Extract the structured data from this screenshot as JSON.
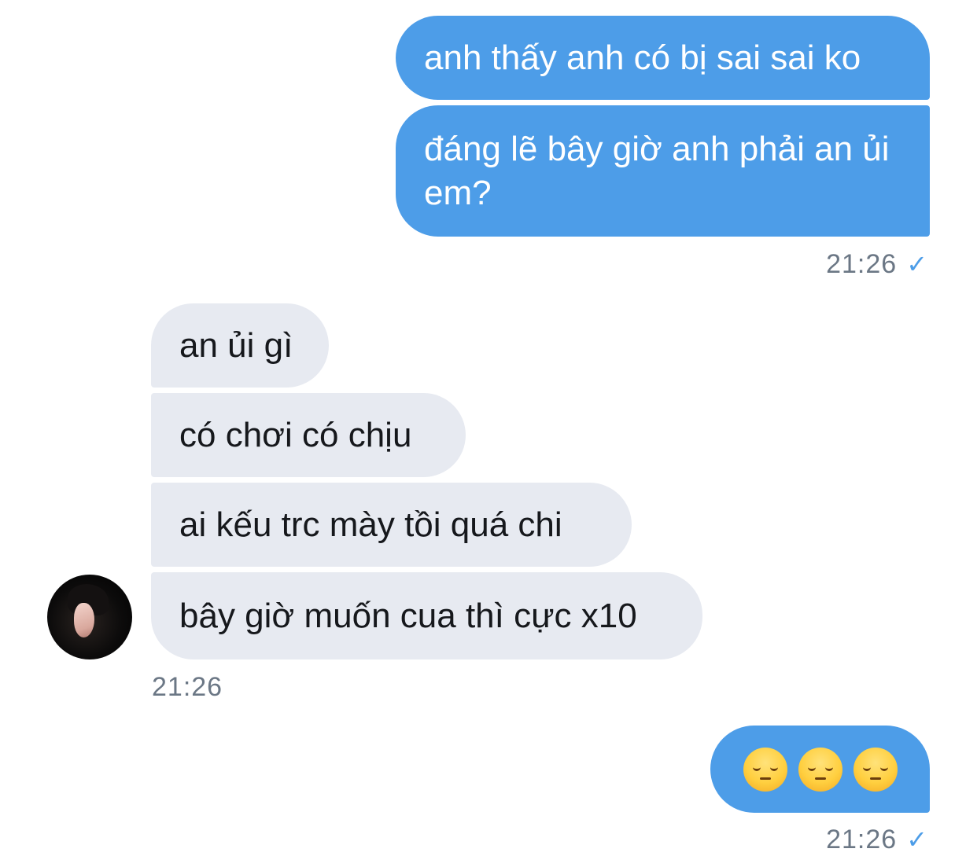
{
  "conversation": {
    "outgoing_group_1": {
      "messages": [
        "anh thấy anh có bị sai sai ko",
        "đáng lẽ bây giờ anh phải an ủi em?"
      ],
      "time": "21:26",
      "status_icon": "checkmark-icon",
      "check_glyph": "✓"
    },
    "incoming_group": {
      "avatar": "contact-avatar",
      "messages": [
        "an ủi gì",
        "có chơi có chịu",
        "ai kếu trc mày tồi quá chi",
        "bây giờ muốn cua thì cực x10"
      ],
      "time": "21:26"
    },
    "outgoing_group_2": {
      "emojis": [
        "pensive-face-emoji",
        "pensive-face-emoji",
        "pensive-face-emoji"
      ],
      "time": "21:26",
      "status_icon": "checkmark-icon",
      "check_glyph": "✓"
    }
  },
  "colors": {
    "outgoing_bubble": "#4d9de8",
    "incoming_bubble": "#e7eaf1",
    "timestamp": "#6b7785"
  }
}
